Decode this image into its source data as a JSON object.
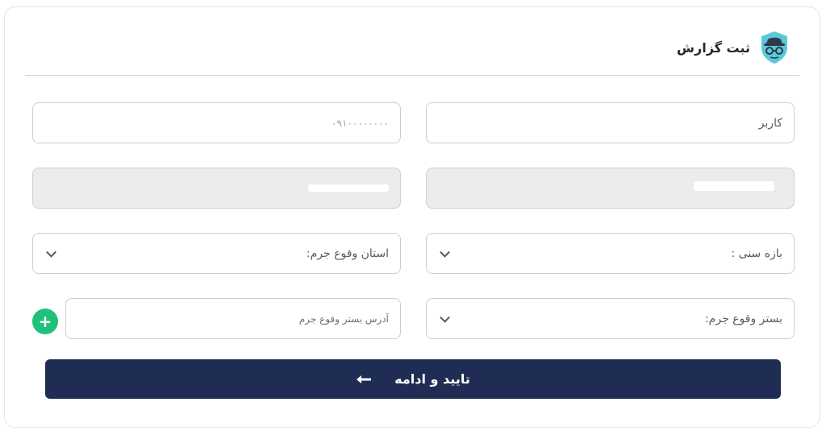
{
  "header": {
    "title": "ثبت گزارش",
    "icon": "detective-shield-icon"
  },
  "form": {
    "user_field": {
      "value": "کاربر"
    },
    "phone_field": {
      "value": "۰۹۱۰۰۰۰۰۰۰۰"
    },
    "name_field": {
      "value": ""
    },
    "email_field": {
      "value": ""
    },
    "age_range": {
      "value": "بازه سنی :"
    },
    "crime_province": {
      "value": "استان وقوع جرم:"
    },
    "crime_platform": {
      "value": "بستر وقوع جرم:"
    },
    "crime_address": {
      "placeholder": "آدرس بستر وقوع جرم"
    }
  },
  "actions": {
    "add_symbol": "+",
    "submit_label": "تایید و ادامه"
  },
  "colors": {
    "primary": "#1f2d54",
    "accent": "#1fc17b",
    "shield": "#5bc8d8"
  }
}
